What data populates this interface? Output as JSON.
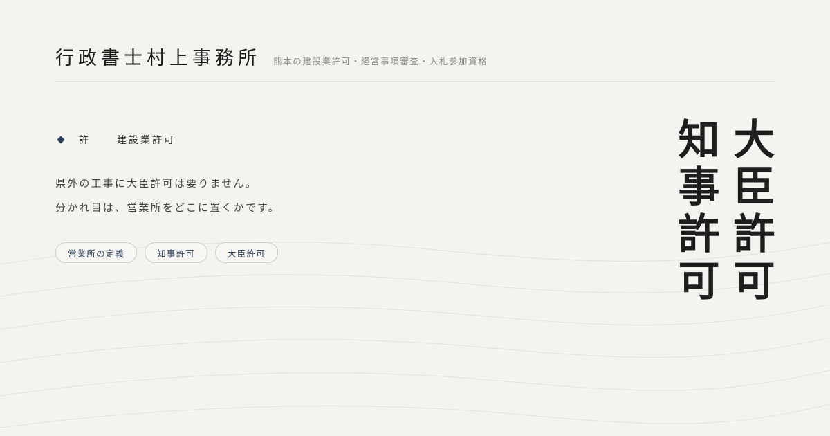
{
  "header": {
    "title": "行政書士村上事務所",
    "tagline": "熊本の建設業許可・経営事項審査・入札参加資格"
  },
  "section": {
    "label_left": "許",
    "label_right": "建設業許可"
  },
  "body": {
    "line1": "県外の工事に大臣許可は要りません。",
    "line2": "分かれ目は、営業所をどこに置くかです。"
  },
  "tags": [
    {
      "label": "営業所の定義"
    },
    {
      "label": "知事許可"
    },
    {
      "label": "大臣許可"
    }
  ],
  "vertical": {
    "right_column": "知事許可",
    "left_column": "大臣許可"
  },
  "colors": {
    "background": "#f4f3ef",
    "accent_navy": "#2b3f5c",
    "text_dark": "#1e1e1e",
    "text_muted": "#8a8a86"
  },
  "icons": {
    "bullet": "diamond-icon"
  }
}
